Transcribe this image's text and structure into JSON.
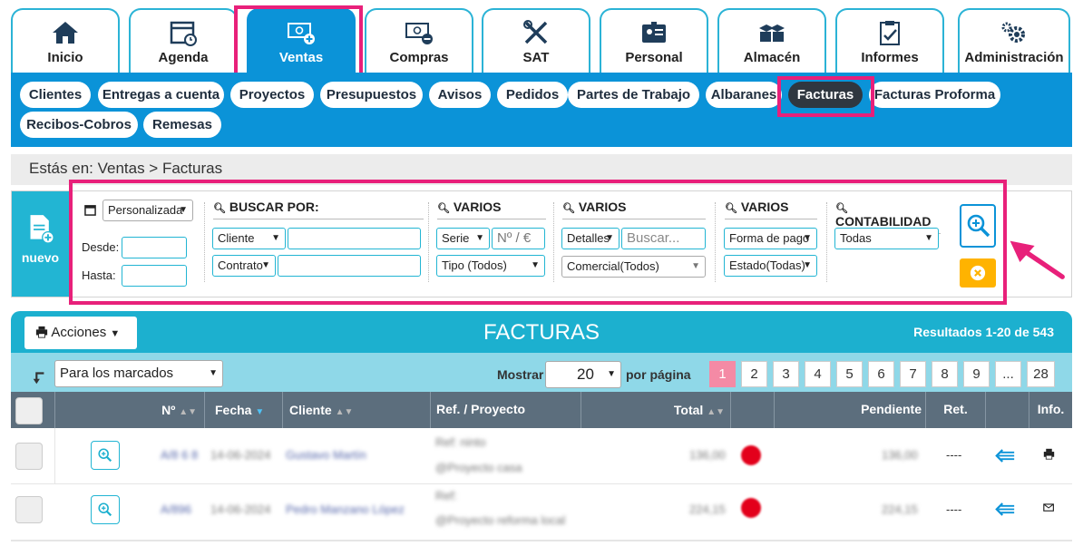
{
  "topnav": {
    "tabs": [
      {
        "label": "Inicio",
        "icon": "home-icon"
      },
      {
        "label": "Agenda",
        "icon": "calendar-icon"
      },
      {
        "label": "Ventas",
        "icon": "money-plus-icon"
      },
      {
        "label": "Compras",
        "icon": "money-minus-icon"
      },
      {
        "label": "SAT",
        "icon": "tools-icon"
      },
      {
        "label": "Personal",
        "icon": "id-card-icon"
      },
      {
        "label": "Almacén",
        "icon": "boxes-icon"
      },
      {
        "label": "Informes",
        "icon": "clipboard-icon"
      },
      {
        "label": "Administración",
        "icon": "gears-icon"
      }
    ]
  },
  "subnav": {
    "items": [
      "Clientes",
      "Entregas a cuenta",
      "Proyectos",
      "Presupuestos",
      "Avisos",
      "Pedidos",
      "Partes de Trabajo",
      "Albaranes",
      "Facturas",
      "Facturas Proforma",
      "Recibos-Cobros",
      "Remesas"
    ]
  },
  "breadcrumb": "Estás en: Ventas > Facturas",
  "filters": {
    "nuevo_label": "nuevo",
    "date_select": "Personalizada",
    "desde_label": "Desde:",
    "hasta_label": "Hasta:",
    "buscar_header": "BUSCAR POR:",
    "varios1_header": "VARIOS",
    "varios2_header": "VARIOS",
    "varios3_header": "VARIOS",
    "contabilidad_header": "CONTABILIDAD",
    "cliente_select": "Cliente",
    "contrato_select": "Contrato",
    "serie_select": "Serie",
    "numero_placeholder": "Nº / €",
    "tipo_select": "Tipo (Todos)",
    "detalles_select": "Detalles",
    "buscar_placeholder": "Buscar...",
    "comercial_select": "Comercial(Todos)",
    "forma_pago_select": "Forma de pago",
    "estado_select": "Estado(Todas)",
    "contabilidad_select": "Todas"
  },
  "table": {
    "acciones_label": "Acciones",
    "title": "FACTURAS",
    "results": "Resultados 1-20 de 543",
    "marcados_select": "Para los marcados",
    "mostrar_label": "Mostrar",
    "per_page_value": "20",
    "por_pagina_label": "por página",
    "pages": [
      "1",
      "2",
      "3",
      "4",
      "5",
      "6",
      "7",
      "8",
      "9",
      "...",
      "28"
    ],
    "columns": [
      "Nº",
      "Fecha",
      "Cliente",
      "Ref. / Proyecto",
      "Total",
      "Pendiente",
      "Ret.",
      "Info."
    ],
    "rows": [
      {
        "num": "A/8 6 8",
        "fecha": "14-06-2024",
        "cliente": "Gustavo Martín",
        "ref1": "Ref: ninto",
        "ref2": "@Proyecto casa",
        "total": "136,00",
        "pendiente": "136,00",
        "ret": "----",
        "info_icon": "print-icon"
      },
      {
        "num": "A/896",
        "fecha": "14-06-2024",
        "cliente": "Pedro Manzano López",
        "ref1": "Ref:",
        "ref2": "@Proyecto reforma local",
        "total": "224,15",
        "pendiente": "224,15",
        "ret": "----",
        "info_icon": "mail-icon"
      }
    ]
  },
  "colors": {
    "primary": "#0b93d8",
    "teal": "#1cb0cf",
    "highlight": "#e8207a",
    "status_red": "#e3001b"
  }
}
